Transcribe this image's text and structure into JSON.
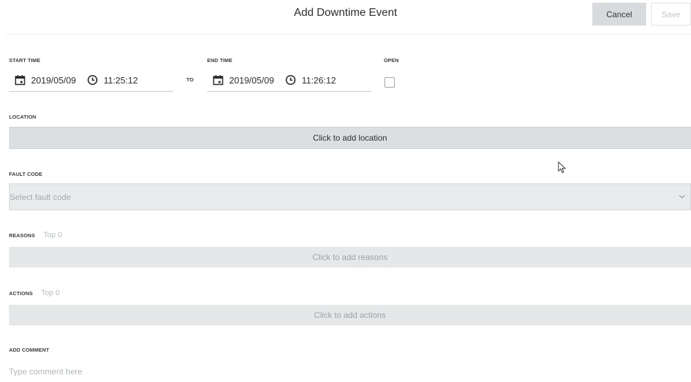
{
  "header": {
    "title": "Add Downtime Event",
    "cancel_label": "Cancel",
    "save_label": "Save"
  },
  "start_time": {
    "label": "START TIME",
    "date": "2019/05/09",
    "time": "11:25:12"
  },
  "to_label": "TO",
  "end_time": {
    "label": "END TIME",
    "date": "2019/05/09",
    "time": "11:26:12"
  },
  "open": {
    "label": "OPEN",
    "checked": false
  },
  "location": {
    "label": "LOCATION",
    "placeholder": "Click to add location"
  },
  "fault_code": {
    "label": "FAULT CODE",
    "placeholder": "Select fault code"
  },
  "reasons": {
    "label": "REASONS",
    "sub": "Top 0",
    "placeholder": "Click to add reasons"
  },
  "actions": {
    "label": "ACTIONS",
    "sub": "Top 0",
    "placeholder": "Click to add actions"
  },
  "comment": {
    "label": "ADD COMMENT",
    "placeholder": "Type comment here"
  },
  "icons": {
    "date": "calendar-icon",
    "time": "clock-icon",
    "dropdown": "chevron-down-icon",
    "pointer": "mouse-cursor-icon"
  }
}
